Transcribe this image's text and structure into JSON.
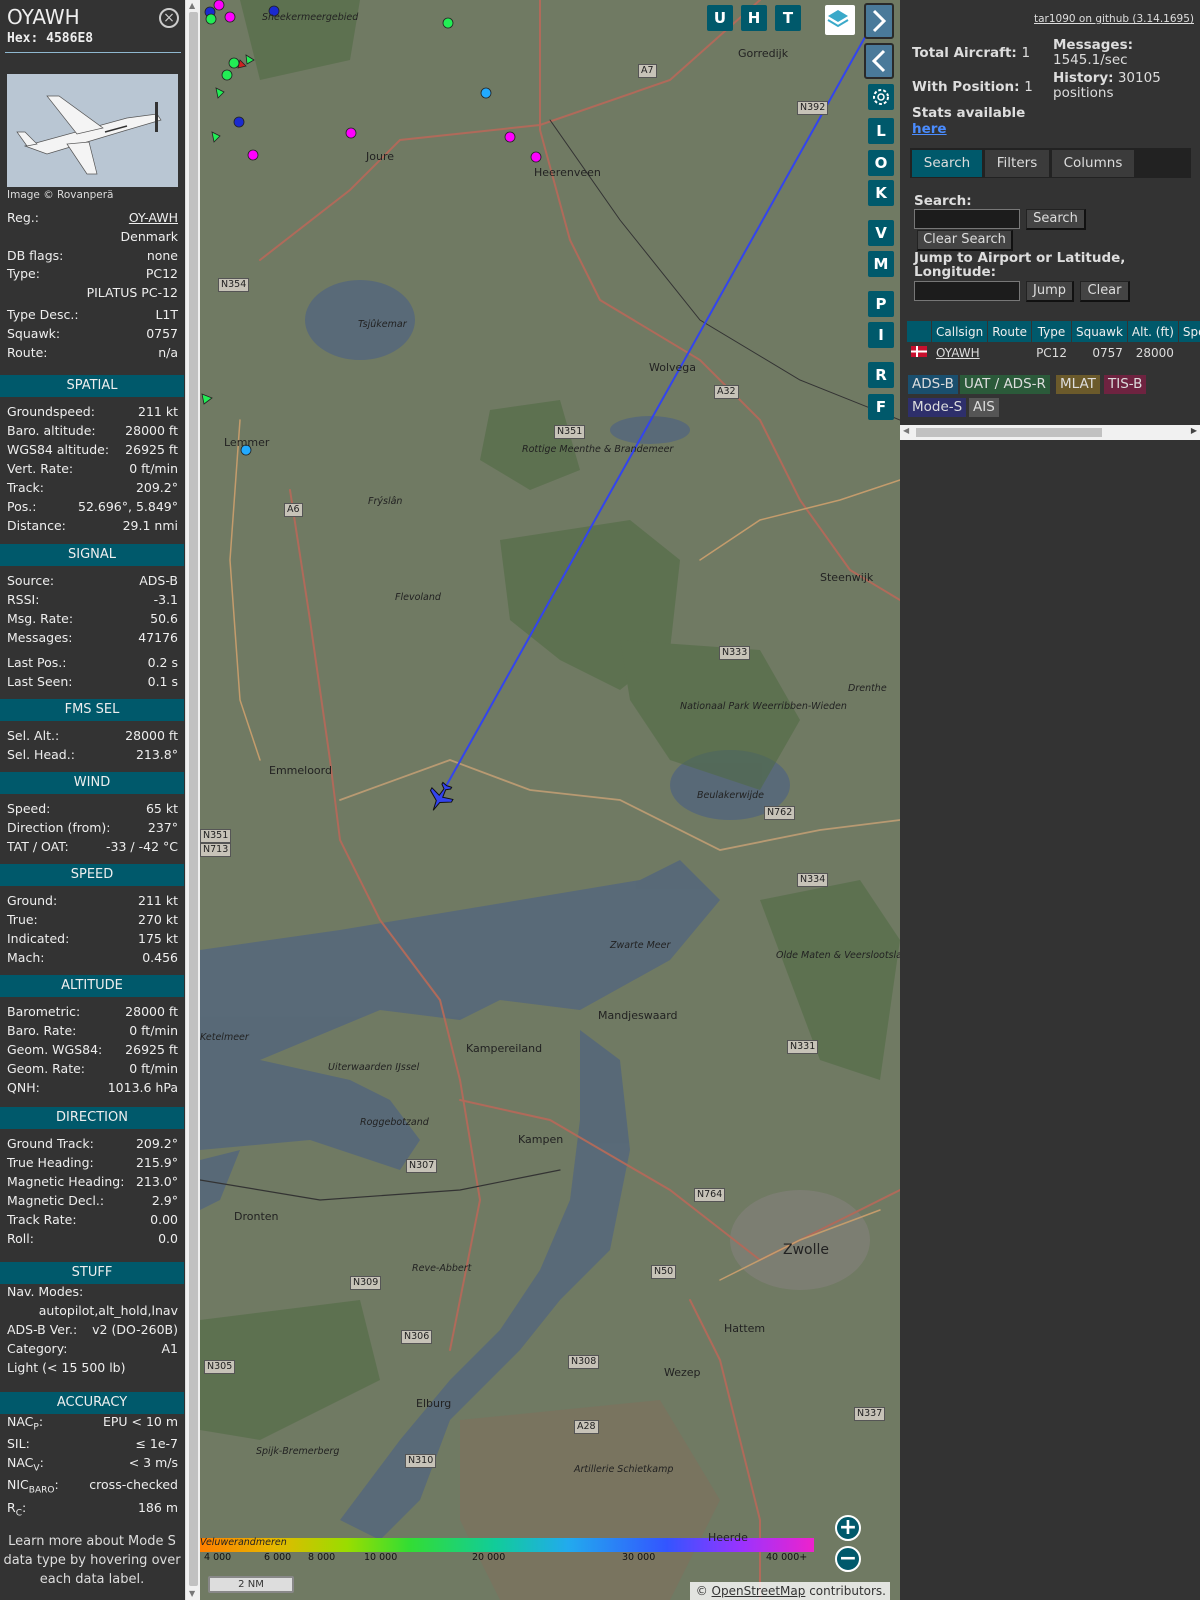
{
  "aircraft": {
    "callsign": "OYAWH",
    "hex_label": "Hex:",
    "hex": "4586E8",
    "image_credit": "Image © Rovanperä"
  },
  "info_rows": [
    {
      "label": "Reg.:",
      "value": "OY-AWH"
    },
    {
      "label": "",
      "value": "Denmark"
    },
    {
      "label": "DB flags:",
      "value": "none"
    },
    {
      "label": "Type:",
      "value": "PC12"
    },
    {
      "label": "",
      "value": "PILATUS PC-12"
    },
    {
      "label": "Type Desc.:",
      "value": "L1T"
    },
    {
      "label": "Squawk:",
      "value": "0757"
    },
    {
      "label": "Route:",
      "value": "n/a"
    }
  ],
  "sections": {
    "spatial": {
      "title": "SPATIAL",
      "rows": [
        {
          "label": "Groundspeed:",
          "value": "211 kt"
        },
        {
          "label": "Baro. altitude:",
          "value": "28000 ft"
        },
        {
          "label": "WGS84 altitude:",
          "value": "26925 ft"
        },
        {
          "label": "Vert. Rate:",
          "value": "0 ft/min"
        },
        {
          "label": "Track:",
          "value": "209.2°"
        },
        {
          "label": "Pos.:",
          "value": "52.696°, 5.849°"
        },
        {
          "label": "Distance:",
          "value": "29.1 nmi"
        }
      ]
    },
    "signal": {
      "title": "SIGNAL",
      "rows": [
        {
          "label": "Source:",
          "value": "ADS-B"
        },
        {
          "label": "RSSI:",
          "value": "-3.1"
        },
        {
          "label": "Msg. Rate:",
          "value": "50.6"
        },
        {
          "label": "Messages:",
          "value": "47176"
        },
        {
          "label": "Last Pos.:",
          "value": "0.2 s"
        },
        {
          "label": "Last Seen:",
          "value": "0.1 s"
        }
      ]
    },
    "fms": {
      "title": "FMS SEL",
      "rows": [
        {
          "label": "Sel. Alt.:",
          "value": "28000 ft"
        },
        {
          "label": "Sel. Head.:",
          "value": "213.8°"
        }
      ]
    },
    "wind": {
      "title": "WIND",
      "rows": [
        {
          "label": "Speed:",
          "value": "65 kt"
        },
        {
          "label": "Direction (from):",
          "value": "237°"
        },
        {
          "label": "TAT / OAT:",
          "value": "-33 / -42 °C"
        }
      ]
    },
    "speed": {
      "title": "SPEED",
      "rows": [
        {
          "label": "Ground:",
          "value": "211 kt"
        },
        {
          "label": "True:",
          "value": "270 kt"
        },
        {
          "label": "Indicated:",
          "value": "175 kt"
        },
        {
          "label": "Mach:",
          "value": "0.456"
        }
      ]
    },
    "altitude": {
      "title": "ALTITUDE",
      "rows": [
        {
          "label": "Barometric:",
          "value": "28000 ft"
        },
        {
          "label": "Baro. Rate:",
          "value": "0 ft/min"
        },
        {
          "label": "Geom. WGS84:",
          "value": "26925 ft"
        },
        {
          "label": "Geom. Rate:",
          "value": "0 ft/min"
        },
        {
          "label": "QNH:",
          "value": "1013.6 hPa"
        }
      ]
    },
    "direction": {
      "title": "DIRECTION",
      "rows": [
        {
          "label": "Ground Track:",
          "value": "209.2°"
        },
        {
          "label": "True Heading:",
          "value": "215.9°"
        },
        {
          "label": "Magnetic Heading:",
          "value": "213.0°"
        },
        {
          "label": "Magnetic Decl.:",
          "value": "2.9°"
        },
        {
          "label": "Track Rate:",
          "value": "0.00"
        },
        {
          "label": "Roll:",
          "value": "0.0"
        }
      ]
    },
    "stuff": {
      "title": "STUFF",
      "nav_label": "Nav. Modes:",
      "nav_value": "autopilot,alt_hold,lnav",
      "rows": [
        {
          "label": "ADS-B Ver.:",
          "value": "v2 (DO-260B)"
        },
        {
          "label": "Category:",
          "value": "A1"
        }
      ],
      "category_desc": "Light (< 15 500 lb)"
    },
    "accuracy": {
      "title": "ACCURACY",
      "nacp": {
        "label": "NAC",
        "sub": "P",
        "suffix": ":",
        "value": "EPU < 10 m"
      },
      "sil": {
        "label": "SIL:",
        "value": "≤ 1e-7"
      },
      "nacv": {
        "label": "NAC",
        "sub": "V",
        "suffix": ":",
        "value": "< 3 m/s"
      },
      "nicbaro": {
        "label": "NIC",
        "sub": "BARO",
        "suffix": ":",
        "value": "cross-checked"
      },
      "rc": {
        "label": "R",
        "sub": "C",
        "suffix": ":",
        "value": "186 m"
      }
    }
  },
  "help_note": "Learn more about Mode S data type by hovering over each data label.",
  "map": {
    "places": [
      {
        "text": "Gorredijk",
        "big": false
      },
      {
        "text": "Joure",
        "big": false
      },
      {
        "text": "Heerenveen",
        "big": false
      },
      {
        "text": "Wolvega",
        "big": false
      },
      {
        "text": "Lemmer",
        "big": false
      },
      {
        "text": "Steenwijk",
        "big": false
      },
      {
        "text": "Emmeloord",
        "big": false
      },
      {
        "text": "Kampereiland",
        "big": false
      },
      {
        "text": "Kampen",
        "big": false
      },
      {
        "text": "Dronten",
        "big": false
      },
      {
        "text": "Zwolle",
        "big": true
      },
      {
        "text": "Hattem",
        "big": false
      },
      {
        "text": "Wezep",
        "big": false
      },
      {
        "text": "Elburg",
        "big": false
      },
      {
        "text": "Heerde",
        "big": false
      },
      {
        "text": "Mandjeswaard",
        "big": false
      },
      {
        "text": "Tsjûkemar",
        "big": false
      },
      {
        "text": "Nationaal Park Weerribben-Wieden",
        "big": false
      },
      {
        "text": "Zwarte Meer",
        "big": false
      },
      {
        "text": "Flevoland",
        "big": false
      },
      {
        "text": "Frýslân",
        "big": false
      },
      {
        "text": "Rottige Meenthe & Brandemeer",
        "big": false
      },
      {
        "text": "Beulakerwijde",
        "big": false
      },
      {
        "text": "Olde Maten & Veerslootslanden",
        "big": false
      },
      {
        "text": "Uiterwaarden IJssel",
        "big": false
      },
      {
        "text": "Roggebotzand",
        "big": false
      },
      {
        "text": "Reve-Abbert",
        "big": false
      },
      {
        "text": "Ketelmeer",
        "big": false
      },
      {
        "text": "Artillerie Schietkamp",
        "big": false
      },
      {
        "text": "Veluwerandmeren",
        "big": false
      },
      {
        "text": "Spijk-Bremerberg",
        "big": false
      },
      {
        "text": "Sneekermeergebied",
        "big": false
      },
      {
        "text": "Drenthe",
        "big": false
      }
    ],
    "roads": [
      "A7",
      "N392",
      "N354",
      "N351",
      "A32",
      "A6",
      "N333",
      "N762",
      "N334",
      "N351",
      "N713",
      "N331",
      "N307",
      "N764",
      "N309",
      "N50",
      "N306",
      "N308",
      "N305",
      "A28",
      "N310",
      "N337"
    ],
    "buttons": [
      "U",
      "H",
      "T",
      "L",
      "O",
      "K",
      "V",
      "M",
      "P",
      "I",
      "R",
      "F"
    ],
    "legend_ticks": [
      "4 000",
      "6 000",
      "8 000",
      "10 000",
      "20 000",
      "30 000",
      "40 000+"
    ],
    "scale": "2 NM",
    "attribution_prefix": "© ",
    "attribution_link": "OpenStreetMap",
    "attribution_suffix": " contributors."
  },
  "right": {
    "github": "tar1090 on github (3.14.1695)",
    "total_label": "Total Aircraft:",
    "total_value": "1",
    "withpos_label": "With Position:",
    "withpos_value": "1",
    "messages_label": "Messages:",
    "messages_value": "1545.1/sec",
    "history_label": "History:",
    "history_value": "30105 positions",
    "stats_label": "Stats available",
    "stats_link": "here",
    "tabs": [
      "Search",
      "Filters",
      "Columns"
    ],
    "search_label": "Search:",
    "search_btn": "Search",
    "clear_search_btn": "Clear Search",
    "jump_label": "Jump to Airport or Latitude, Longitude:",
    "jump_btn": "Jump",
    "clear_btn": "Clear",
    "table_headers": [
      "",
      "Callsign",
      "Route",
      "Type",
      "Squawk",
      "Alt. (ft)",
      "Spd."
    ],
    "table_rows": [
      {
        "flag": "DK",
        "callsign": "OYAWH",
        "route": "",
        "type": "PC12",
        "squawk": "0757",
        "alt": "28000",
        "spd": ""
      }
    ],
    "chips": [
      {
        "label": "ADS-B",
        "color": "#1a4f6e"
      },
      {
        "label": "UAT / ADS-R",
        "color": "#2b5a3a"
      },
      {
        "label": "MLAT",
        "color": "#6b5a2b"
      },
      {
        "label": "TIS-B",
        "color": "#6e2340"
      },
      {
        "label": "Mode-S",
        "color": "#2e2f6b"
      },
      {
        "label": "AIS",
        "color": "#555555"
      }
    ]
  }
}
